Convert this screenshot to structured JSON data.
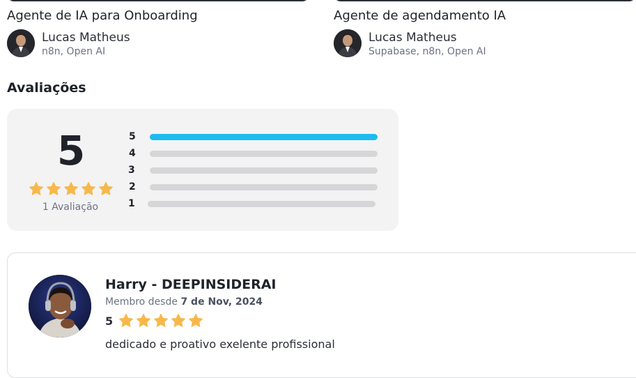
{
  "agents": [
    {
      "title": "Agente de IA para Onboarding",
      "author": "Lucas Matheus",
      "tags": "n8n, Open AI"
    },
    {
      "title": "Agente de agendamento IA",
      "author": "Lucas Matheus",
      "tags": "Supabase, n8n, Open AI"
    }
  ],
  "ratings": {
    "section_title": "Avaliações",
    "average": "5",
    "average_stars": 5,
    "review_count_label": "1 Avaliação",
    "distribution": [
      {
        "label": "5",
        "fraction": 1.0
      },
      {
        "label": "4",
        "fraction": 0.0
      },
      {
        "label": "3",
        "fraction": 0.0
      },
      {
        "label": "2",
        "fraction": 0.0
      },
      {
        "label": "1",
        "fraction": 0.0
      }
    ],
    "colors": {
      "star": "#f7b84b",
      "bar_fill": "#1cbcf0",
      "bar_track": "#d6d6d9"
    }
  },
  "review": {
    "reviewer_name": "Harry - DEEPINSIDERAI",
    "member_since_prefix": "Membro desde",
    "member_since_date": "7 de Nov, 2024",
    "score": "5",
    "stars": 5,
    "text": "dedicado e proativo exelente profissional"
  }
}
